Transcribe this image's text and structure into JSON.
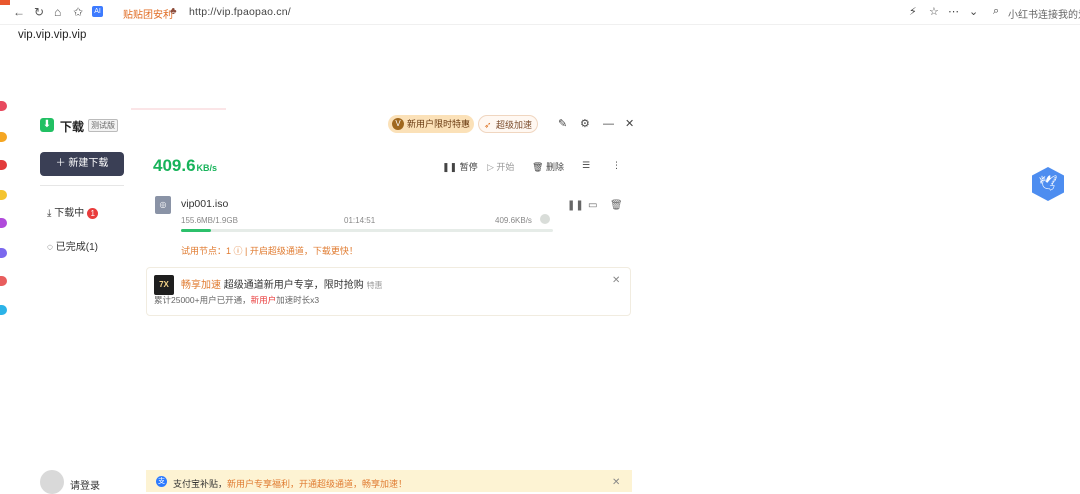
{
  "browser": {
    "url": "http://vip.fpaopao.cn/",
    "tip_text": "贴贴团安利",
    "search_hint": "小红书连接我的爱",
    "ai_ext": "AI"
  },
  "page": {
    "heading": "vip.vip.vip.vip"
  },
  "app": {
    "title": "下载",
    "tag": "测试版",
    "new_task_label": "新建下载",
    "sidebar": {
      "downloading_label": "下载中",
      "downloading_count": "1",
      "completed_label": "已完成(1)"
    },
    "username": "请登录",
    "header": {
      "vip_pill": "新用户限时特惠",
      "speed_pill": "超级加速"
    },
    "speed_value": "409.6",
    "speed_unit": "KB/s",
    "toolbar": {
      "pause_all": "暂停",
      "start_all": "开始",
      "delete": "删除"
    },
    "item": {
      "name": "vip001.iso",
      "size": "155.6MB/1.9GB",
      "time_left": "01:14:51",
      "speed": "409.6KB/s",
      "progress": 0.08,
      "accel_note": "试用节点：1 ⓘ | 开启超级通道，下载更快！"
    },
    "promo": {
      "logo": "7X",
      "brand": "畅享加速",
      "title": "超级通道新用户专享，限时抢购",
      "tag": "特惠",
      "sub_before": "累计25000+用户已开通，",
      "sub_highlight": "新用户",
      "sub_after": "加速时长x3"
    },
    "notice": {
      "icon": "支",
      "lead": "支付宝补贴，",
      "highlight": "新用户专享福利，开通超级通道，畅享加速！"
    }
  }
}
